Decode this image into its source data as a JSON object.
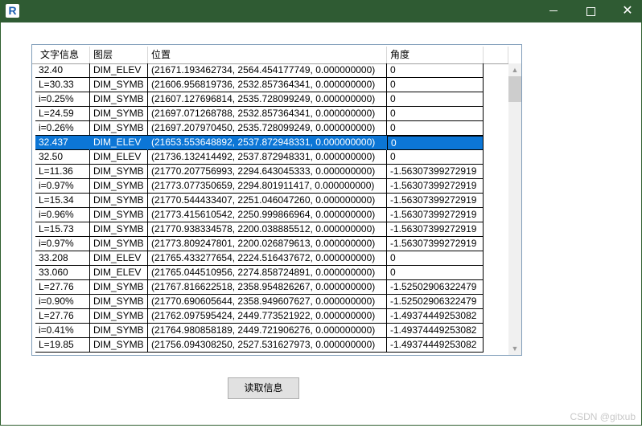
{
  "window": {
    "controls": {
      "minimize_icon": "minimize-icon",
      "maximize_icon": "maximize-icon",
      "close_icon": "close-icon",
      "close_glyph": "✕"
    },
    "app_icon_letter": "R",
    "titlebar_color": "#2f5b33"
  },
  "grid": {
    "columns": [
      "文字信息",
      "图层",
      "位置",
      "角度",
      ""
    ],
    "rows": [
      {
        "text": "32.40",
        "layer": "DIM_ELEV",
        "position": "(21671.193462734, 2564.454177749, 0.000000000)",
        "angle": "0"
      },
      {
        "text": "L=30.33",
        "layer": "DIM_SYMB",
        "position": "(21606.956819736, 2532.857364341, 0.000000000)",
        "angle": "0"
      },
      {
        "text": "i=0.25%",
        "layer": "DIM_SYMB",
        "position": "(21607.127696814, 2535.728099249, 0.000000000)",
        "angle": "0"
      },
      {
        "text": "L=24.59",
        "layer": "DIM_SYMB",
        "position": "(21697.071268788, 2532.857364341, 0.000000000)",
        "angle": "0"
      },
      {
        "text": "i=0.26%",
        "layer": "DIM_SYMB",
        "position": "(21697.207970450, 2535.728099249, 0.000000000)",
        "angle": "0"
      },
      {
        "text": "32.437",
        "layer": "DIM_ELEV",
        "position": "(21653.553648892, 2537.872948331, 0.000000000)",
        "angle": "0",
        "selected": true
      },
      {
        "text": "32.50",
        "layer": "DIM_ELEV",
        "position": "(21736.132414492, 2537.872948331, 0.000000000)",
        "angle": "0"
      },
      {
        "text": "L=11.36",
        "layer": "DIM_SYMB",
        "position": "(21770.207756993, 2294.643045333, 0.000000000)",
        "angle": "-1.56307399272919"
      },
      {
        "text": "i=0.97%",
        "layer": "DIM_SYMB",
        "position": "(21773.077350659, 2294.801911417, 0.000000000)",
        "angle": "-1.56307399272919"
      },
      {
        "text": "L=15.34",
        "layer": "DIM_SYMB",
        "position": "(21770.544433407, 2251.046047260, 0.000000000)",
        "angle": "-1.56307399272919"
      },
      {
        "text": "i=0.96%",
        "layer": "DIM_SYMB",
        "position": "(21773.415610542, 2250.999866964, 0.000000000)",
        "angle": "-1.56307399272919"
      },
      {
        "text": "L=15.73",
        "layer": "DIM_SYMB",
        "position": "(21770.938334578, 2200.038885512, 0.000000000)",
        "angle": "-1.56307399272919"
      },
      {
        "text": "i=0.97%",
        "layer": "DIM_SYMB",
        "position": "(21773.809247801, 2200.026879613, 0.000000000)",
        "angle": "-1.56307399272919"
      },
      {
        "text": "33.208",
        "layer": "DIM_ELEV",
        "position": "(21765.433277654, 2224.516437672, 0.000000000)",
        "angle": "0"
      },
      {
        "text": "33.060",
        "layer": "DIM_ELEV",
        "position": "(21765.044510956, 2274.858724891, 0.000000000)",
        "angle": "0"
      },
      {
        "text": "L=27.76",
        "layer": "DIM_SYMB",
        "position": "(21767.816622518, 2358.954826267, 0.000000000)",
        "angle": "-1.52502906322479"
      },
      {
        "text": "i=0.90%",
        "layer": "DIM_SYMB",
        "position": "(21770.690605644, 2358.949607627, 0.000000000)",
        "angle": "-1.52502906322479"
      },
      {
        "text": "L=27.76",
        "layer": "DIM_SYMB",
        "position": "(21762.097595424, 2449.773521922, 0.000000000)",
        "angle": "-1.49374449253082"
      },
      {
        "text": "i=0.41%",
        "layer": "DIM_SYMB",
        "position": "(21764.980858189, 2449.721906276, 0.000000000)",
        "angle": "-1.49374449253082"
      },
      {
        "text": "L=19.85",
        "layer": "DIM_SYMB",
        "position": "(21756.094308250, 2527.531627973, 0.000000000)",
        "angle": "-1.49374449253082"
      }
    ],
    "selected_color": "#0c76d6"
  },
  "read_button": {
    "label": "读取信息"
  },
  "watermark": "CSDN @gitxub"
}
